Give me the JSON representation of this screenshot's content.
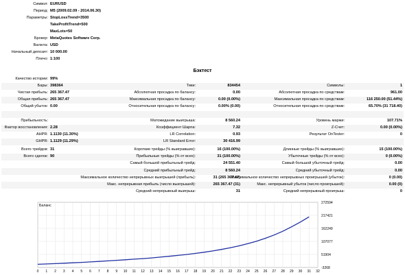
{
  "header": {
    "symbol": {
      "label": "Символ:",
      "value": "EURUSD"
    },
    "period": {
      "label": "Период:",
      "value": "M5 (2009.02.09 - 2014.06.30)"
    },
    "params": {
      "label": "Параметры:",
      "values": [
        "StopLossTrend=3500",
        "TakeProfitTrend=500",
        "MaxLots=50"
      ]
    },
    "broker": {
      "label": "Брокер:",
      "value": "MetaQuotes Software Corp."
    },
    "currency": {
      "label": "Валюта:",
      "value": "USD"
    },
    "deposit": {
      "label": "Начальный депозит:",
      "value": "10 000.00"
    },
    "leverage": {
      "label": "Плечо:",
      "value": "1:100"
    }
  },
  "section_title": "Бэктест",
  "stats1": [
    [
      "Качество истории:",
      "99%",
      "",
      "",
      "",
      ""
    ],
    [
      "Бары:",
      "398364",
      "Тики:",
      "834454",
      "Символы:",
      "1"
    ],
    [
      "Чистая прибыль:",
      "265 367.47",
      "Абсолютная просадка по балансу:",
      "0.00",
      "Абсолютная просадка по средствам:",
      "961.00"
    ],
    [
      "Общая прибыль:",
      "265 367.47",
      "Максимальная просадка по балансу:",
      "0.00 (0.00%)",
      "Максимальная просадка по средствам:",
      "116 250.00 (51.44%)"
    ],
    [
      "Общий убыток:",
      "0.00",
      "Относительная просадка по балансу:",
      "0.00% (0.00)",
      "Относительная просадка по средствам:",
      "65.70% (31 718.40)"
    ],
    [
      "",
      "",
      "",
      "",
      "",
      ""
    ],
    [
      "Прибыльность:",
      "",
      "Матожидание выигрыша:",
      "8 560.24",
      "Уровень маржи:",
      "107.71%"
    ],
    [
      "Фактор восстановления:",
      "2.28",
      "Коэффициент Шарпа:",
      "7.32",
      "Z-Счет:",
      "0.00 (0.00%)"
    ],
    [
      "AHPR:",
      "1.1130 (11.30%)",
      "LR Correlation:",
      "0.93",
      "Результат OnTester:",
      "0"
    ],
    [
      "GHPR:",
      "1.1129 (11.29%)",
      "LR Standard Error:",
      "30 416.99",
      "",
      ""
    ]
  ],
  "stats2": [
    [
      "Всего трейдов:",
      "31",
      "Короткие трейды (% выигравших):",
      "16 (100.00%)",
      "Длинные трейды (% выигравших):",
      "15 (100.00%)"
    ],
    [
      "Всего сделок:",
      "90",
      "Прибыльные трейды (% от всех):",
      "31 (100.00%)",
      "Убыточные трейды (% от всех):",
      "0 (0.00%)"
    ],
    [
      "",
      "",
      "Самый большой прибыльный трейд:",
      "24 551.40",
      "Самый большой убыточный трейд:",
      "0.00"
    ],
    [
      "",
      "",
      "Средний прибыльный трейд:",
      "8 560.24",
      "Средний убыточный трейд:",
      "0.00"
    ],
    [
      "",
      "",
      "Максимальное количество непрерывных выигрышей (прибыль):",
      "31 (265 367.47)",
      "Максимальное количество непрерывных проигрышей (убыток):",
      "0 (0.00)"
    ],
    [
      "",
      "",
      "Макс. непрерывная прибыль (число выигрышей):",
      "265 367.47 (31)",
      "Макс. непрерывный убыток (число проигрышей):",
      "0.00 (0)"
    ],
    [
      "",
      "",
      "Средний непрерывный выигрыш:",
      "31",
      "Средний непрерывный проигрыш:",
      "0"
    ]
  ],
  "chart": {
    "title": "Баланс",
    "line_color": "#1f2fa0"
  },
  "chart_data": {
    "type": "line",
    "title": "Баланс",
    "xlim": [
      0,
      32
    ],
    "ylim": [
      -3268,
      272594
    ],
    "x_ticks": [
      0,
      1,
      2,
      3,
      4,
      5,
      6,
      7,
      8,
      9,
      10,
      11,
      12,
      13,
      14,
      15,
      16,
      17,
      18,
      19,
      20,
      21,
      22,
      23,
      24,
      25,
      26,
      27,
      28,
      29,
      30,
      31,
      32
    ],
    "y_ticks": [
      272594,
      217421,
      162249,
      107077,
      51904,
      -3268
    ],
    "series": [
      {
        "x": [
          0,
          1,
          2,
          3,
          4,
          5,
          6,
          7,
          8,
          9,
          10,
          11,
          12,
          13,
          14,
          15,
          16,
          17,
          18,
          19,
          20,
          21,
          22,
          23,
          24,
          25,
          26,
          27,
          28,
          29,
          30,
          31
        ],
        "values": [
          10000,
          11500,
          13000,
          14700,
          16400,
          18300,
          20300,
          22300,
          24500,
          26800,
          29200,
          31800,
          34300,
          37200,
          40500,
          44000,
          47700,
          51600,
          56200,
          61100,
          66600,
          73100,
          80100,
          88200,
          97400,
          108000,
          120000,
          134000,
          150000,
          169000,
          189000,
          211000
        ]
      }
    ]
  }
}
